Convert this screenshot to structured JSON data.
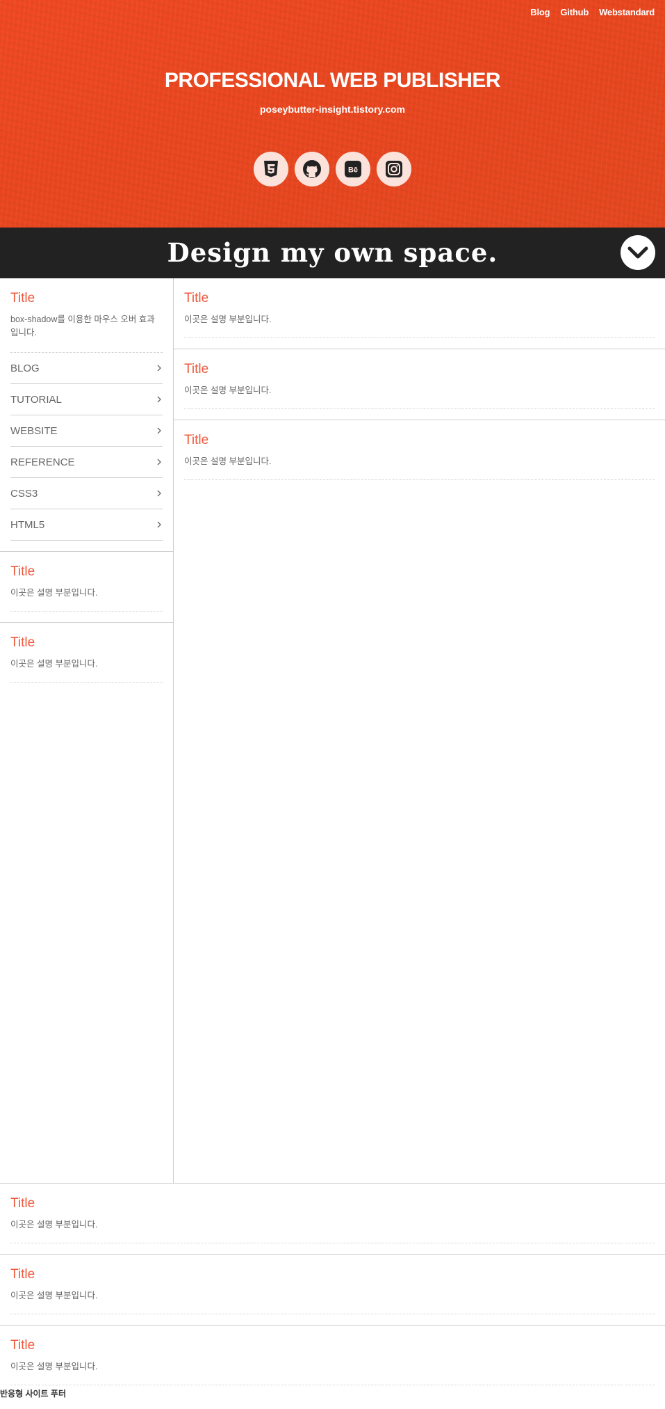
{
  "topnav": [
    "Blog",
    "Github",
    "Webstandard"
  ],
  "header": {
    "title": "PROFESSIONAL WEB PUBLISHER",
    "url": "poseybutter-insight.tistory.com",
    "social_icons": [
      "html5-icon",
      "github-icon",
      "behance-icon",
      "instagram-icon"
    ]
  },
  "banner": {
    "slogan": "Design my own space.",
    "down_icon": "chevron-down-icon"
  },
  "aside": {
    "intro": {
      "title": "Title",
      "desc": "box-shadow를 이용한 마우스 오버 효과입니다."
    },
    "menu": [
      "BLOG",
      "TUTORIAL",
      "WEBSITE",
      "REFERENCE",
      "CSS3",
      "HTML5"
    ],
    "cards": [
      {
        "title": "Title",
        "desc": "이곳은 설명 부분입니다."
      },
      {
        "title": "Title",
        "desc": "이곳은 설명 부분입니다."
      }
    ]
  },
  "main": {
    "cards": [
      {
        "title": "Title",
        "desc": "이곳은 설명 부분입니다."
      },
      {
        "title": "Title",
        "desc": "이곳은 설명 부분입니다."
      },
      {
        "title": "Title",
        "desc": "이곳은 설명 부분입니다."
      }
    ]
  },
  "bottom": {
    "cards": [
      {
        "title": "Title",
        "desc": "이곳은 설명 부분입니다."
      },
      {
        "title": "Title",
        "desc": "이곳은 설명 부분입니다."
      },
      {
        "title": "Title",
        "desc": "이곳은 설명 부분입니다."
      }
    ]
  },
  "footer": {
    "text": "반응형 사이트 푸터"
  },
  "colors": {
    "header_bg": "#e8461f",
    "banner_bg": "#222222",
    "accent": "#ef5a3c",
    "icon_circle": "#fbe3dc"
  }
}
